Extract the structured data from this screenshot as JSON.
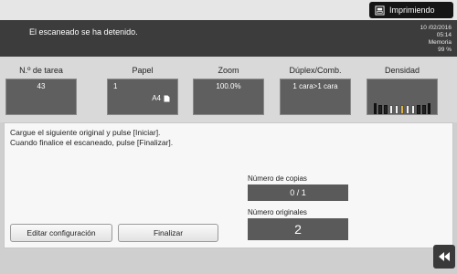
{
  "header": {
    "print_button_label": "Imprimiendo"
  },
  "status": {
    "message": "El escaneado se ha detenido.",
    "date": "10 /02/2016",
    "time": "05:14",
    "memory_label": "Memoria",
    "memory_value": "99 %"
  },
  "params": {
    "job_number": {
      "label": "N.º de tarea",
      "value": "43"
    },
    "paper": {
      "label": "Papel",
      "tray": "1",
      "size": "A4"
    },
    "zoom": {
      "label": "Zoom",
      "value": "100.0%"
    },
    "duplex": {
      "label": "Dúplex/Comb.",
      "value": "1 cara>1 cara"
    },
    "density": {
      "label": "Densidad",
      "levels": 9,
      "selected_level": 5
    }
  },
  "main": {
    "instruction_line1": "Cargue el siguiente original y pulse [Iniciar].",
    "instruction_line2": "Cuando finalice el escaneado, pulse [Finalizar].",
    "copies_label": "Número de copias",
    "copies_value": "0 / 1",
    "originals_label": "Número originales",
    "originals_value": "2",
    "edit_button_label": "Editar configuración",
    "finish_button_label": "Finalizar"
  },
  "icons": {
    "print": "printer-icon",
    "paper_orientation": "portrait-page-icon",
    "back": "rewind-icon"
  }
}
